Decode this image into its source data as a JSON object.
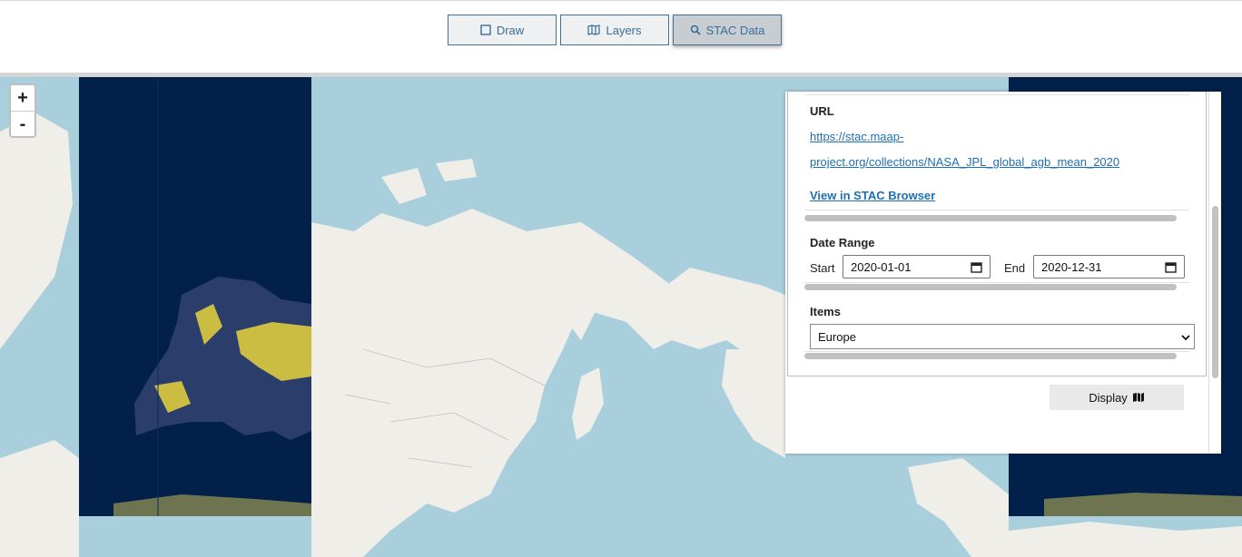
{
  "toolbar": {
    "draw_label": "Draw",
    "layers_label": "Layers",
    "stac_label": "STAC Data"
  },
  "zoom": {
    "in": "+",
    "out": "-"
  },
  "panel": {
    "url_heading": "URL",
    "url_line1": "https://stac.maap-",
    "url_line2": "project.org/collections/NASA_JPL_global_agb_mean_2020",
    "browser_link": "View in STAC Browser",
    "date_heading": "Date Range",
    "start_label": "Start",
    "start_value": "2020-01-01",
    "end_label": "End",
    "end_value": "2020-12-31",
    "items_heading": "Items",
    "items_selected": "Europe",
    "display_label": "Display"
  },
  "colors": {
    "ocean": "#a9cfdc",
    "land": "#f0eee9",
    "raster_bg": "#03204a",
    "raster_high": "#f7e33a",
    "link": "#1f6fb0"
  }
}
